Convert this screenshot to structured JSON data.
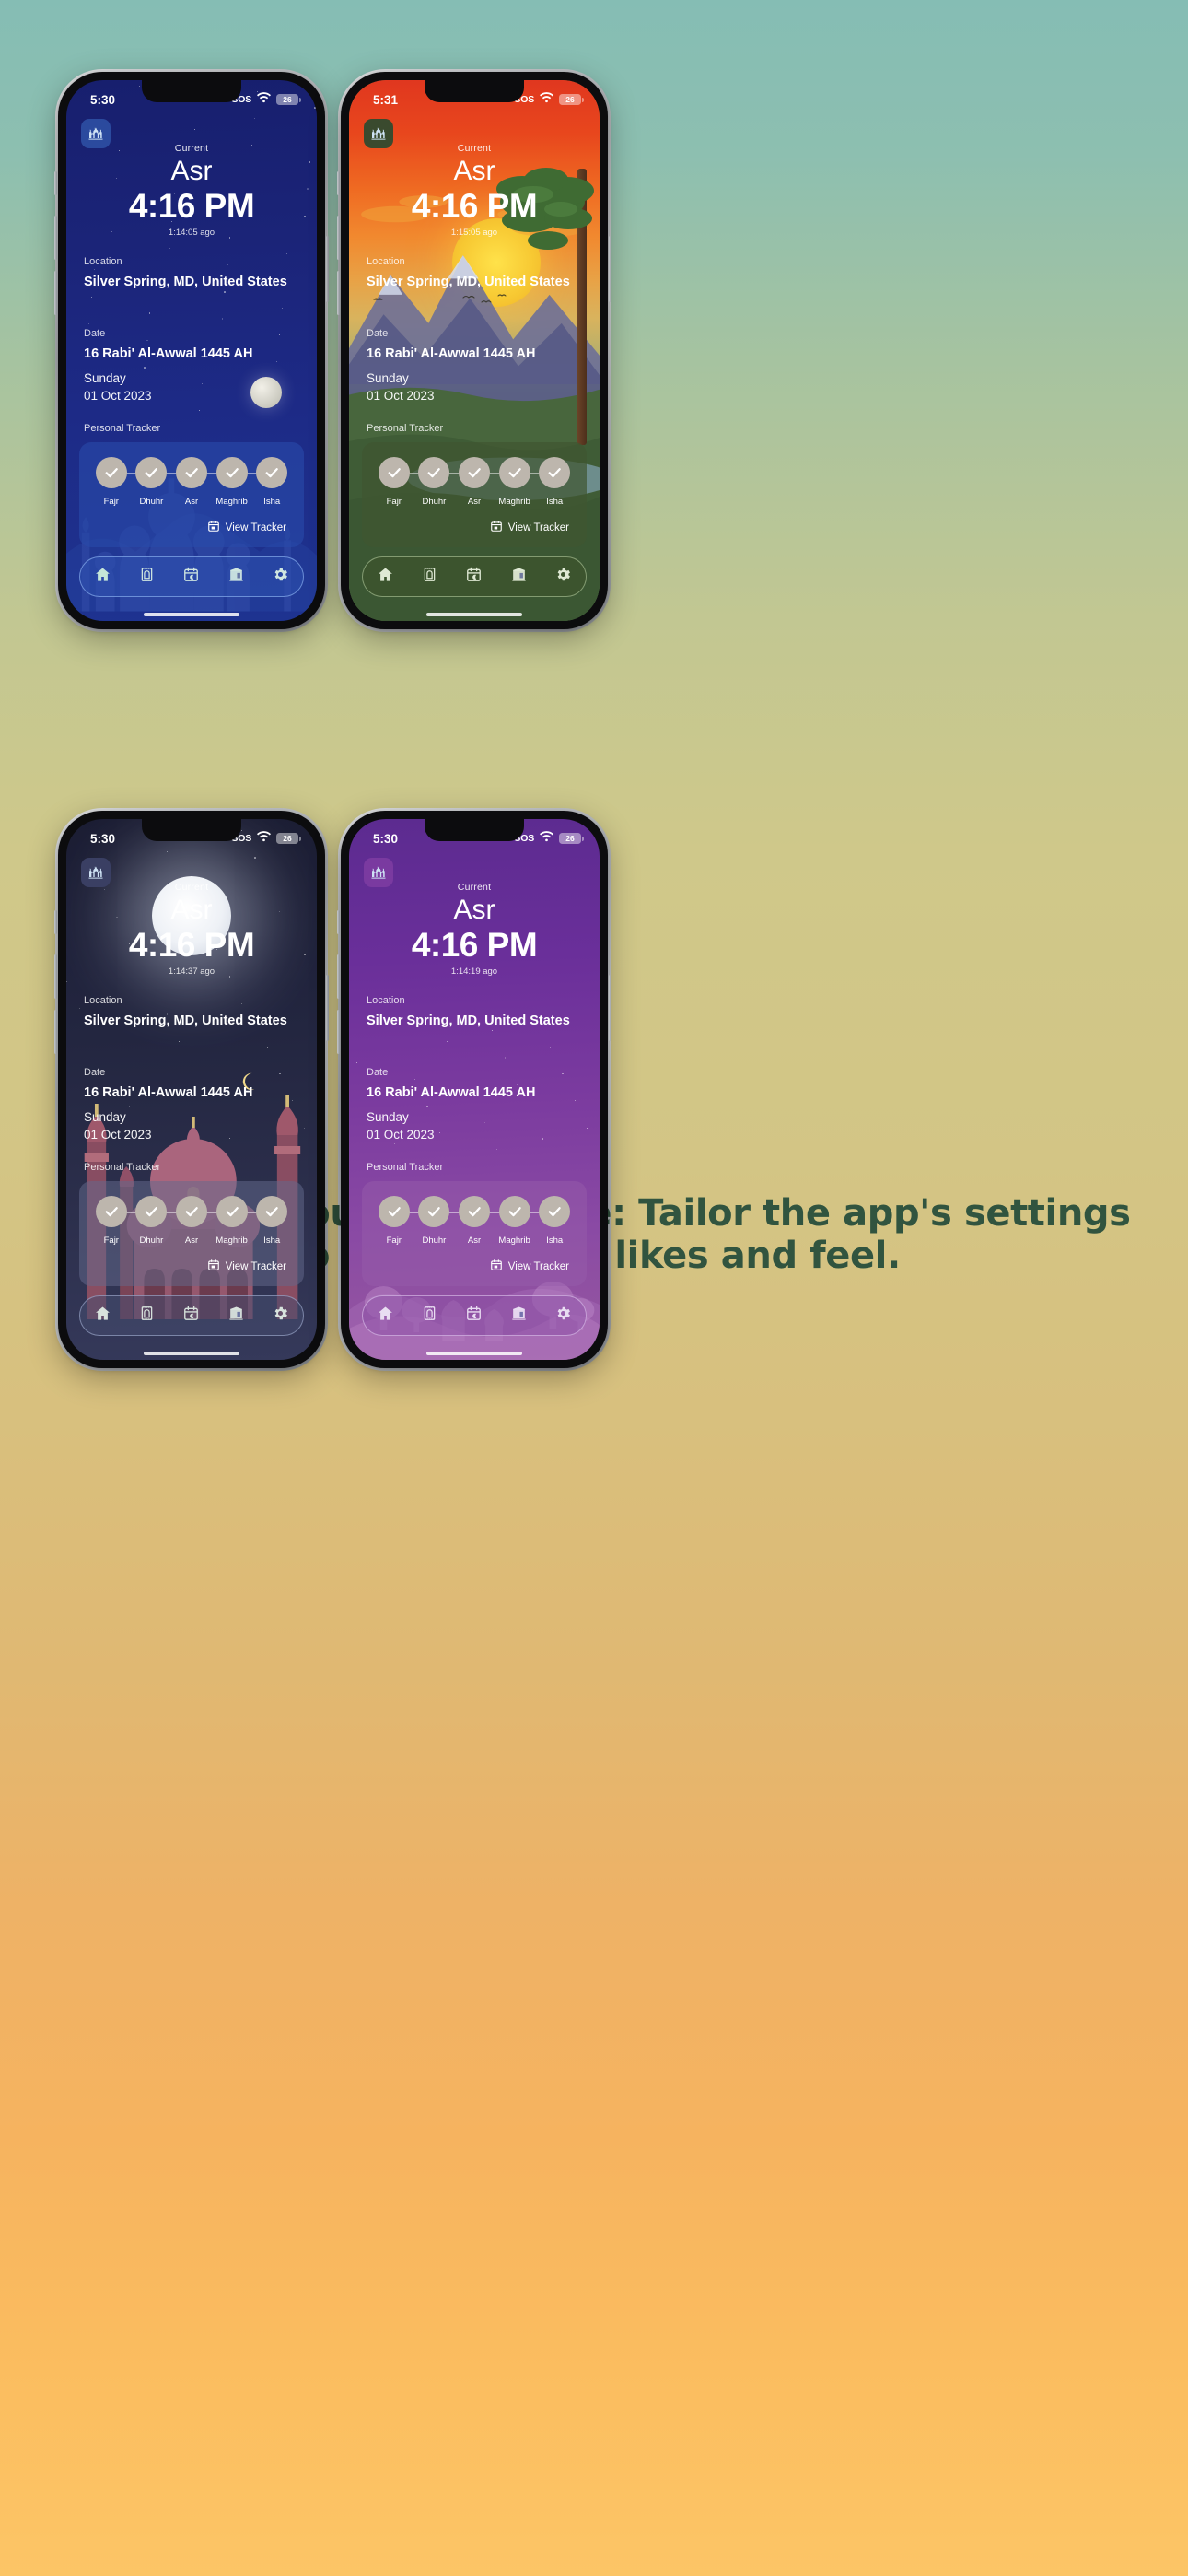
{
  "headline": "Customize Your Experience: Tailor the app's settings to your specific likes and feel.",
  "labels": {
    "current": "Current",
    "location": "Location",
    "date": "Date",
    "personal_tracker": "Personal Tracker",
    "view_tracker": "View Tracker"
  },
  "prayers": [
    {
      "name": "Fajr"
    },
    {
      "name": "Dhuhr"
    },
    {
      "name": "Asr"
    },
    {
      "name": "Maghrib"
    },
    {
      "name": "Isha"
    }
  ],
  "nav_items": [
    {
      "icon": "home-icon",
      "name": "nav-home"
    },
    {
      "icon": "prayer-mat-icon",
      "name": "nav-prayer"
    },
    {
      "icon": "calendar-moon-icon",
      "name": "nav-calendar"
    },
    {
      "icon": "kaaba-icon",
      "name": "nav-qibla"
    },
    {
      "icon": "gear-icon",
      "name": "nav-settings"
    }
  ],
  "colors": {
    "navy": "#1b2478",
    "sunset_green": "#4d6b3c",
    "mosque_night": "#232640",
    "purple": "#6a2f9a",
    "headline_text": "#31543f",
    "tracker_dot": "#bdb6ad"
  },
  "phones": [
    {
      "id": "phone-navy",
      "status": {
        "time": "5:30",
        "sos": "SOS",
        "battery": "26"
      },
      "prayer_name": "Asr",
      "prayer_time": "4:16 PM",
      "elapsed": "1:14:05 ago",
      "location": "Silver Spring, MD, United States",
      "hijri_date": "16 Rabi' Al-Awwal 1445 AH",
      "weekday": "Sunday",
      "gregorian_date": "01 Oct 2023"
    },
    {
      "id": "phone-sunset",
      "status": {
        "time": "5:31",
        "sos": "SOS",
        "battery": "26"
      },
      "prayer_name": "Asr",
      "prayer_time": "4:16 PM",
      "elapsed": "1:15:05 ago",
      "location": "Silver Spring, MD, United States",
      "hijri_date": "16 Rabi' Al-Awwal 1445 AH",
      "weekday": "Sunday",
      "gregorian_date": "01 Oct 2023"
    },
    {
      "id": "phone-mosque",
      "status": {
        "time": "5:30",
        "sos": "SOS",
        "battery": "26"
      },
      "prayer_name": "Asr",
      "prayer_time": "4:16 PM",
      "elapsed": "1:14:37 ago",
      "location": "Silver Spring, MD, United States",
      "hijri_date": "16 Rabi' Al-Awwal 1445 AH",
      "weekday": "Sunday",
      "gregorian_date": "01 Oct 2023"
    },
    {
      "id": "phone-purple",
      "status": {
        "time": "5:30",
        "sos": "SOS",
        "battery": "26"
      },
      "prayer_name": "Asr",
      "prayer_time": "4:16 PM",
      "elapsed": "1:14:19 ago",
      "location": "Silver Spring, MD, United States",
      "hijri_date": "16 Rabi' Al-Awwal 1445 AH",
      "weekday": "Sunday",
      "gregorian_date": "01 Oct 2023"
    }
  ]
}
